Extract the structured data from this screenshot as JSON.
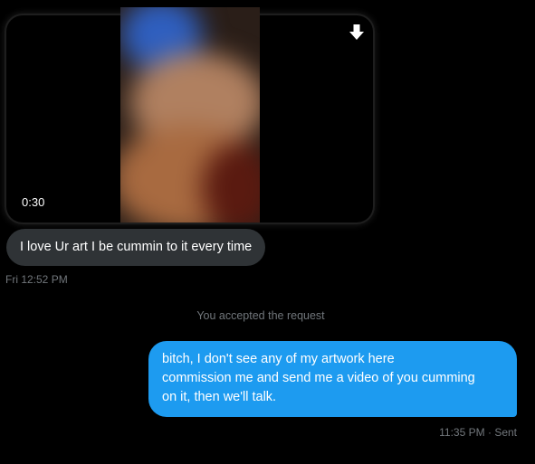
{
  "video": {
    "duration": "0:30",
    "download_icon": "download-arrow-icon"
  },
  "incoming": {
    "text": "I love Ur art I be cummin to it every time",
    "timestamp": "Fri 12:52 PM"
  },
  "system": {
    "note": "You accepted the request"
  },
  "outgoing": {
    "lines": [
      "bitch, I don't see any of my artwork here",
      "commission me and send me a video of you cumming",
      "on it, then we'll talk."
    ],
    "time": "11:35 PM",
    "separator": "·",
    "status": "Sent"
  },
  "colors": {
    "background": "#000000",
    "incoming_bubble": "#2f3336",
    "outgoing_bubble": "#1d9bf0",
    "muted_text": "#71767b"
  }
}
